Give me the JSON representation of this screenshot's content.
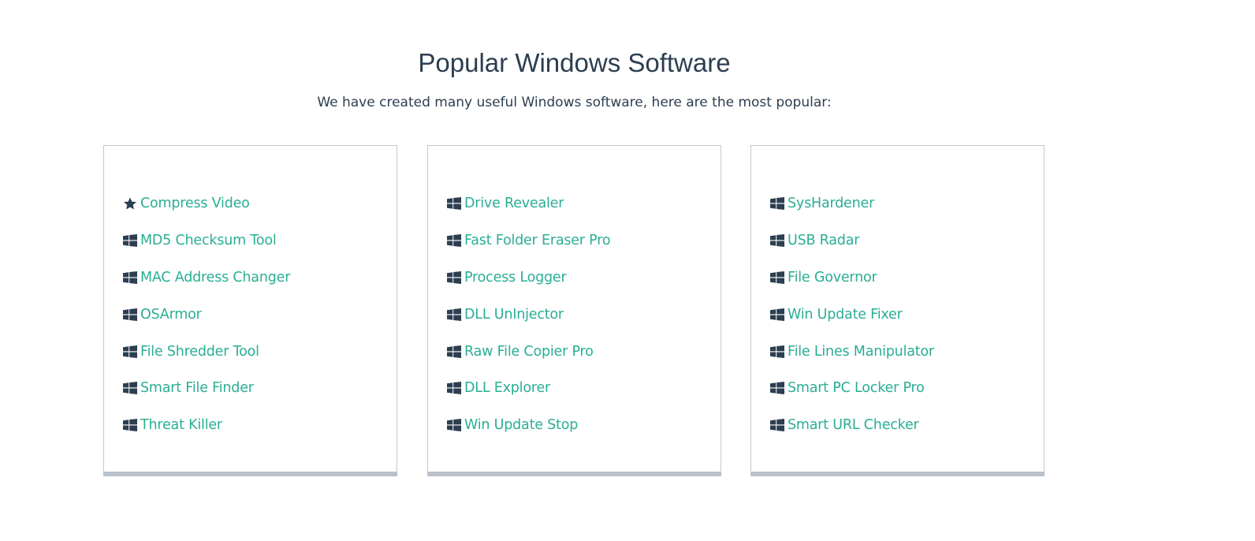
{
  "section": {
    "title": "Popular Windows Software",
    "subtitle": "We have created many useful Windows software, here are the most popular:"
  },
  "colors": {
    "heading": "#2c3e50",
    "link": "#2aae94",
    "icon": "#2c3e50",
    "card_border": "#c4c9d0",
    "card_bottom_bar": "#b9c1cb"
  },
  "columns": [
    {
      "items": [
        {
          "icon": "star-icon",
          "label": "Compress Video"
        },
        {
          "icon": "windows-icon",
          "label": "MD5 Checksum Tool"
        },
        {
          "icon": "windows-icon",
          "label": "MAC Address Changer"
        },
        {
          "icon": "windows-icon",
          "label": "OSArmor"
        },
        {
          "icon": "windows-icon",
          "label": "File Shredder Tool"
        },
        {
          "icon": "windows-icon",
          "label": "Smart File Finder"
        },
        {
          "icon": "windows-icon",
          "label": "Threat Killer"
        }
      ]
    },
    {
      "items": [
        {
          "icon": "windows-icon",
          "label": "Drive Revealer"
        },
        {
          "icon": "windows-icon",
          "label": "Fast Folder Eraser Pro"
        },
        {
          "icon": "windows-icon",
          "label": "Process Logger"
        },
        {
          "icon": "windows-icon",
          "label": "DLL UnInjector"
        },
        {
          "icon": "windows-icon",
          "label": "Raw File Copier Pro"
        },
        {
          "icon": "windows-icon",
          "label": "DLL Explorer"
        },
        {
          "icon": "windows-icon",
          "label": "Win Update Stop"
        }
      ]
    },
    {
      "items": [
        {
          "icon": "windows-icon",
          "label": "SysHardener"
        },
        {
          "icon": "windows-icon",
          "label": "USB Radar"
        },
        {
          "icon": "windows-icon",
          "label": "File Governor"
        },
        {
          "icon": "windows-icon",
          "label": "Win Update Fixer"
        },
        {
          "icon": "windows-icon",
          "label": "File Lines Manipulator"
        },
        {
          "icon": "windows-icon",
          "label": "Smart PC Locker Pro"
        },
        {
          "icon": "windows-icon",
          "label": "Smart URL Checker"
        }
      ]
    }
  ]
}
